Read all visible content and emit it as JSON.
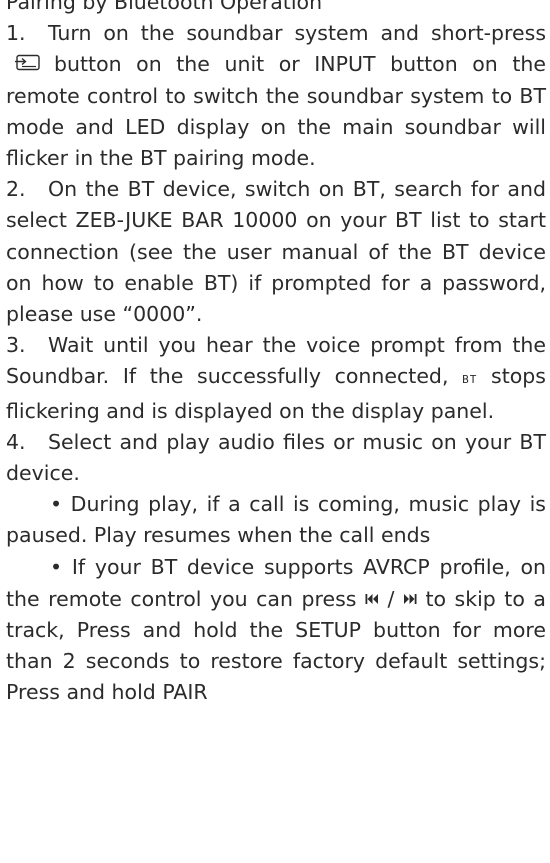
{
  "document": {
    "cut_off_line": "Pairing by Bluetooth Operation",
    "steps": [
      {
        "number": "1.",
        "text_before_icon": "Turn on the soundbar system and short-press",
        "icon": "input-source-icon",
        "text_after_icon": "button on the unit or INPUT button on the remote control to switch the soundbar system to BT mode and LED display on the main soundbar will flicker in the BT pairing mode."
      },
      {
        "number": "2.",
        "text": "On the BT device, switch on BT, search for and select ZEB-JUKE BAR 10000 on your BT list to start connection (see the user manual of the BT device on how to enable BT) if prompted for a password, please use “0000”."
      },
      {
        "number": "3.",
        "text_before_indicator": "Wait until you hear the voice prompt from the Soundbar. If the successfully connected,",
        "indicator": "BT",
        "text_after_indicator": "stops flickering and is displayed on the display panel."
      },
      {
        "number": "4.",
        "text": "Select and play audio files or music on your BT device."
      }
    ],
    "bullets": [
      {
        "symbol": "•",
        "text": "During play, if a call is coming, music play is paused. Play resumes when the call ends"
      },
      {
        "symbol": "•",
        "text_before_icons": "If your BT device supports AVRCP profile, on the remote control you can press",
        "prev_icon": "skip-previous-icon",
        "separator": "/",
        "next_icon": "skip-next-icon",
        "text_after_icons": "to skip to a track, Press and hold the SETUP button for more than 2 seconds to restore factory default settings; Press and hold PAIR"
      }
    ]
  }
}
